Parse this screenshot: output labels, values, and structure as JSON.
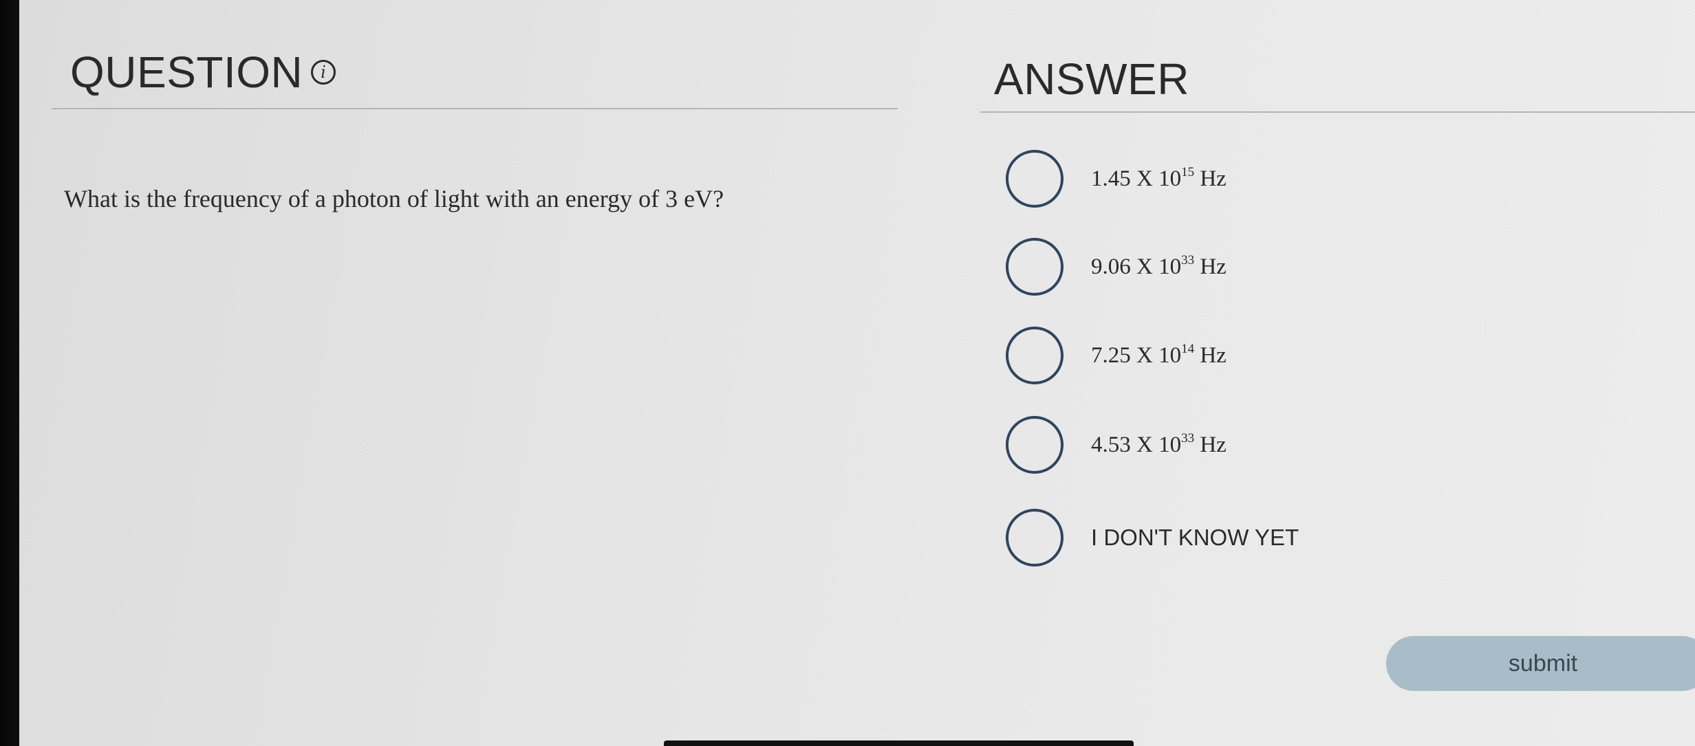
{
  "question": {
    "header": "QUESTION",
    "info_icon": "info-icon",
    "text": "What is the frequency of a photon of light with an energy of 3 eV?"
  },
  "answer": {
    "header": "ANSWER",
    "options": [
      {
        "mantissa": "1.45 X 10",
        "exponent": "15",
        "unit": "Hz"
      },
      {
        "mantissa": "9.06 X 10",
        "exponent": "33",
        "unit": "Hz"
      },
      {
        "mantissa": "7.25 X 10",
        "exponent": "14",
        "unit": "Hz"
      },
      {
        "mantissa": "4.53 X 10",
        "exponent": "33",
        "unit": "Hz"
      },
      {
        "label": "I DON'T KNOW YET"
      }
    ]
  },
  "submit": {
    "label": "submit",
    "color": "#a9bdc9"
  },
  "colors": {
    "radio_border": "#2f4560",
    "text": "#2a2a2a",
    "divider": "#b5b5b5"
  }
}
